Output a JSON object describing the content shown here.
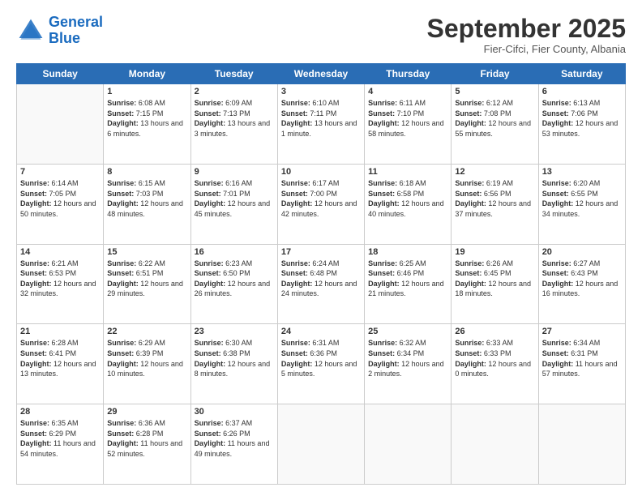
{
  "header": {
    "logo_line1": "General",
    "logo_line2": "Blue",
    "month": "September 2025",
    "location": "Fier-Cifci, Fier County, Albania"
  },
  "days_of_week": [
    "Sunday",
    "Monday",
    "Tuesday",
    "Wednesday",
    "Thursday",
    "Friday",
    "Saturday"
  ],
  "weeks": [
    [
      {
        "day": "",
        "sunrise": "",
        "sunset": "",
        "daylight": ""
      },
      {
        "day": "1",
        "sunrise": "6:08 AM",
        "sunset": "7:15 PM",
        "daylight": "13 hours and 6 minutes."
      },
      {
        "day": "2",
        "sunrise": "6:09 AM",
        "sunset": "7:13 PM",
        "daylight": "13 hours and 3 minutes."
      },
      {
        "day": "3",
        "sunrise": "6:10 AM",
        "sunset": "7:11 PM",
        "daylight": "13 hours and 1 minute."
      },
      {
        "day": "4",
        "sunrise": "6:11 AM",
        "sunset": "7:10 PM",
        "daylight": "12 hours and 58 minutes."
      },
      {
        "day": "5",
        "sunrise": "6:12 AM",
        "sunset": "7:08 PM",
        "daylight": "12 hours and 55 minutes."
      },
      {
        "day": "6",
        "sunrise": "6:13 AM",
        "sunset": "7:06 PM",
        "daylight": "12 hours and 53 minutes."
      }
    ],
    [
      {
        "day": "7",
        "sunrise": "6:14 AM",
        "sunset": "7:05 PM",
        "daylight": "12 hours and 50 minutes."
      },
      {
        "day": "8",
        "sunrise": "6:15 AM",
        "sunset": "7:03 PM",
        "daylight": "12 hours and 48 minutes."
      },
      {
        "day": "9",
        "sunrise": "6:16 AM",
        "sunset": "7:01 PM",
        "daylight": "12 hours and 45 minutes."
      },
      {
        "day": "10",
        "sunrise": "6:17 AM",
        "sunset": "7:00 PM",
        "daylight": "12 hours and 42 minutes."
      },
      {
        "day": "11",
        "sunrise": "6:18 AM",
        "sunset": "6:58 PM",
        "daylight": "12 hours and 40 minutes."
      },
      {
        "day": "12",
        "sunrise": "6:19 AM",
        "sunset": "6:56 PM",
        "daylight": "12 hours and 37 minutes."
      },
      {
        "day": "13",
        "sunrise": "6:20 AM",
        "sunset": "6:55 PM",
        "daylight": "12 hours and 34 minutes."
      }
    ],
    [
      {
        "day": "14",
        "sunrise": "6:21 AM",
        "sunset": "6:53 PM",
        "daylight": "12 hours and 32 minutes."
      },
      {
        "day": "15",
        "sunrise": "6:22 AM",
        "sunset": "6:51 PM",
        "daylight": "12 hours and 29 minutes."
      },
      {
        "day": "16",
        "sunrise": "6:23 AM",
        "sunset": "6:50 PM",
        "daylight": "12 hours and 26 minutes."
      },
      {
        "day": "17",
        "sunrise": "6:24 AM",
        "sunset": "6:48 PM",
        "daylight": "12 hours and 24 minutes."
      },
      {
        "day": "18",
        "sunrise": "6:25 AM",
        "sunset": "6:46 PM",
        "daylight": "12 hours and 21 minutes."
      },
      {
        "day": "19",
        "sunrise": "6:26 AM",
        "sunset": "6:45 PM",
        "daylight": "12 hours and 18 minutes."
      },
      {
        "day": "20",
        "sunrise": "6:27 AM",
        "sunset": "6:43 PM",
        "daylight": "12 hours and 16 minutes."
      }
    ],
    [
      {
        "day": "21",
        "sunrise": "6:28 AM",
        "sunset": "6:41 PM",
        "daylight": "12 hours and 13 minutes."
      },
      {
        "day": "22",
        "sunrise": "6:29 AM",
        "sunset": "6:39 PM",
        "daylight": "12 hours and 10 minutes."
      },
      {
        "day": "23",
        "sunrise": "6:30 AM",
        "sunset": "6:38 PM",
        "daylight": "12 hours and 8 minutes."
      },
      {
        "day": "24",
        "sunrise": "6:31 AM",
        "sunset": "6:36 PM",
        "daylight": "12 hours and 5 minutes."
      },
      {
        "day": "25",
        "sunrise": "6:32 AM",
        "sunset": "6:34 PM",
        "daylight": "12 hours and 2 minutes."
      },
      {
        "day": "26",
        "sunrise": "6:33 AM",
        "sunset": "6:33 PM",
        "daylight": "12 hours and 0 minutes."
      },
      {
        "day": "27",
        "sunrise": "6:34 AM",
        "sunset": "6:31 PM",
        "daylight": "11 hours and 57 minutes."
      }
    ],
    [
      {
        "day": "28",
        "sunrise": "6:35 AM",
        "sunset": "6:29 PM",
        "daylight": "11 hours and 54 minutes."
      },
      {
        "day": "29",
        "sunrise": "6:36 AM",
        "sunset": "6:28 PM",
        "daylight": "11 hours and 52 minutes."
      },
      {
        "day": "30",
        "sunrise": "6:37 AM",
        "sunset": "6:26 PM",
        "daylight": "11 hours and 49 minutes."
      },
      {
        "day": "",
        "sunrise": "",
        "sunset": "",
        "daylight": ""
      },
      {
        "day": "",
        "sunrise": "",
        "sunset": "",
        "daylight": ""
      },
      {
        "day": "",
        "sunrise": "",
        "sunset": "",
        "daylight": ""
      },
      {
        "day": "",
        "sunrise": "",
        "sunset": "",
        "daylight": ""
      }
    ]
  ]
}
